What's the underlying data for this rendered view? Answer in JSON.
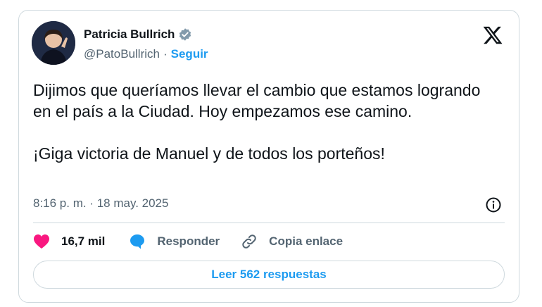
{
  "author": {
    "name": "Patricia Bullrich",
    "handle": "@PatoBullrich",
    "separator": "·",
    "follow_label": "Seguir",
    "verified": true,
    "avatar_icon": "profile-photo"
  },
  "tweet": {
    "paragraphs": [
      "Dijimos que queríamos llevar el cambio que estamos logrando en el país a la Ciudad. Hoy empezamos ese camino.",
      "¡Giga victoria de Manuel y de todos los porteños!"
    ],
    "timestamp": "8:16 p. m. · 18 may. 2025"
  },
  "actions": {
    "likes_count": "16,7 mil",
    "reply_label": "Responder",
    "copy_link_label": "Copia enlace",
    "read_replies_label": "Leer 562 respuestas"
  },
  "icons": {
    "brand": "x-logo-icon",
    "info": "info-icon",
    "like": "heart-icon",
    "reply": "speech-bubble-icon",
    "link": "link-icon",
    "verified": "verified-badge-icon"
  },
  "colors": {
    "accent": "#1d9bf0",
    "like": "#f91880",
    "text": "#0f1419",
    "muted": "#536471",
    "border": "#cfd9de",
    "verified_badge": "#829aab"
  }
}
